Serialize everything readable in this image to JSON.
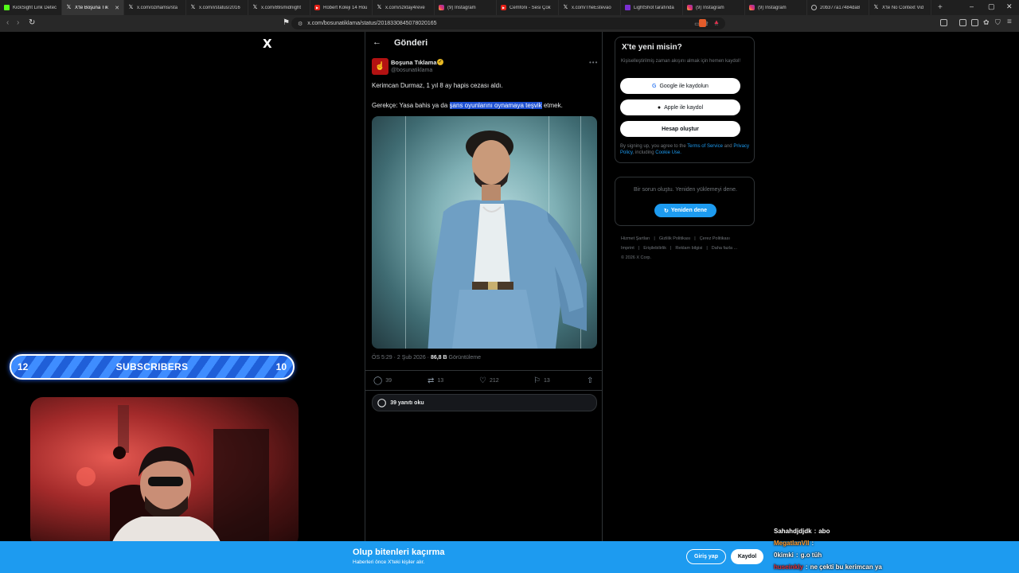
{
  "browser": {
    "tabs": [
      {
        "title": "KickSight Link Detec",
        "icon": "kicksight-icon",
        "active": false
      },
      {
        "title": "X'te Boşuna Tık",
        "icon": "x-icon",
        "active": true
      },
      {
        "title": "x.com/ozihamsi/sta",
        "icon": "x-icon",
        "active": false
      },
      {
        "title": "x.com/i/status/2016",
        "icon": "x-icon",
        "active": false
      },
      {
        "title": "x.com/89smidnight",
        "icon": "x-icon",
        "active": false
      },
      {
        "title": "Robert Koleji 14 Hou",
        "icon": "youtube-icon",
        "active": false
      },
      {
        "title": "x.com/szktay4reve",
        "icon": "x-icon",
        "active": false
      },
      {
        "title": "(9) Instagram",
        "icon": "instagram-icon",
        "active": false
      },
      {
        "title": "Cemfoni - Sesi Çok",
        "icon": "youtube-icon",
        "active": false
      },
      {
        "title": "x.com/TheEstevao",
        "icon": "x-icon",
        "active": false
      },
      {
        "title": "LightShot tarafında",
        "icon": "lightshot-icon",
        "active": false
      },
      {
        "title": "(9) Instagram",
        "icon": "instagram-icon",
        "active": false
      },
      {
        "title": "(9) Instagram",
        "icon": "instagram-icon",
        "active": false
      },
      {
        "title": "20b377a17484da8",
        "icon": "globe-icon",
        "active": false
      },
      {
        "title": "X'te No Context Vid",
        "icon": "x-icon",
        "active": false
      }
    ],
    "new_tab": "+",
    "url": "x.com/bosunatiklama/status/2018330845078020165"
  },
  "x_logo": "X",
  "post": {
    "header_title": "Gönderi",
    "author_name": "Boşuna Tıklama",
    "author_handle": "@bosunatiklama",
    "text_line1": "Kerimcan Durmaz, 1 yıl 8 ay hapis cezası aldı.",
    "text_line2_pre": "Gerekçe: Yasa bahis ya da ",
    "text_line2_highlight": "şans oyunlarını oynamaya teşvik",
    "text_line2_post": " etmek.",
    "timestamp": "ÖS 5:29 · 2 Şub 2026 · ",
    "views_count": "86,8 B",
    "views_label": " Görüntüleme",
    "replies": "39",
    "reposts": "13",
    "likes": "212",
    "bookmarks": "13",
    "read_replies_label": "39 yanıtı oku"
  },
  "sidebar": {
    "signup_title": "X'te yeni misin?",
    "signup_sub": "Kişiselleştirilmiş zaman akışını almak için hemen kaydol!",
    "google_button": "Google ile kaydolun",
    "apple_button": "Apple ile kaydol",
    "create_account_button": "Hesap oluştur",
    "terms_pre": "By signing up, you agree to the ",
    "terms_link": "Terms of Service",
    "terms_and": " and ",
    "privacy_link": "Privacy Policy",
    "terms_including": ", including ",
    "cookie_link": "Cookie Use.",
    "error_text": "Bir sorun oluştu. Yeniden yüklemeyi dene.",
    "retry_button": "Yeniden dene",
    "footer_links": [
      "Hizmet Şartları",
      "Gizlilik Politikası",
      "Çerez Politikası",
      "Imprint",
      "Erişilebilirlik",
      "Reklam bilgisi",
      "Daha fazla ...",
      "© 2026 X Corp."
    ]
  },
  "overlay": {
    "sub_left": "12",
    "sub_label": "SUBSCRIBERS",
    "sub_right": "10",
    "chat": [
      {
        "user": "Sahahdjdjdk",
        "message": "abo",
        "user_color": "#ffffff"
      },
      {
        "user": "MegatlanVII",
        "message": "",
        "user_color": "#ff9a2e"
      },
      {
        "user": "0kimki",
        "message": "g.o tüh",
        "user_color": "#ffffff"
      },
      {
        "user": "huseinkly",
        "message": "ne çekti bu kerimcan ya",
        "user_color": "#e0303a"
      }
    ]
  },
  "banner": {
    "title": "Olup bitenleri kaçırma",
    "subtitle": "Haberleri önce X'teki kişiler alır.",
    "login_button": "Giriş yap",
    "register_button": "Kaydol"
  },
  "colors": {
    "accent": "#1d9bf0",
    "highlight": "#1c4fd1",
    "background": "#000000"
  }
}
